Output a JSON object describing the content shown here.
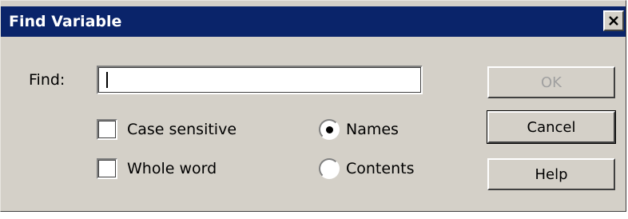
{
  "window": {
    "title": "Find Variable",
    "close_icon": "close-x-icon"
  },
  "find": {
    "label": "Find:",
    "value": ""
  },
  "options": {
    "case_sensitive": {
      "label": "Case sensitive",
      "checked": false
    },
    "whole_word": {
      "label": "Whole word",
      "checked": false
    }
  },
  "search_in": {
    "names": {
      "label": "Names",
      "selected": true
    },
    "contents": {
      "label": "Contents",
      "selected": false
    }
  },
  "buttons": {
    "ok": "OK",
    "cancel": "Cancel",
    "help": "Help"
  }
}
